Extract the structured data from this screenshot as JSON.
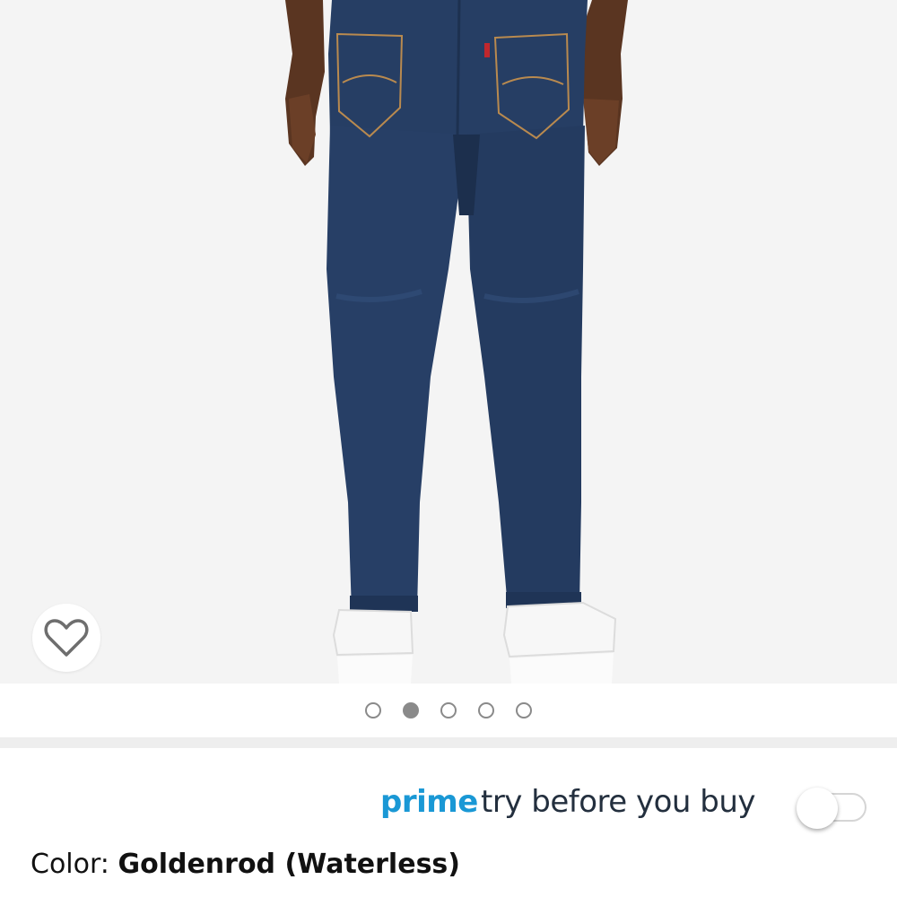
{
  "product_image": {
    "subject": "dark-wash denim jeans back view",
    "background_color": "#f4f4f4",
    "denim_color": "#263e64"
  },
  "wishlist": {
    "icon": "heart-outline-icon"
  },
  "carousel": {
    "total": 5,
    "active_index": 1
  },
  "prime": {
    "brand": "prime",
    "tagline": "try before you buy",
    "brand_color": "#1a98d5",
    "tagline_color": "#232f3e",
    "toggle_on": false
  },
  "color": {
    "label": "Color: ",
    "value": "Goldenrod (Waterless)"
  }
}
